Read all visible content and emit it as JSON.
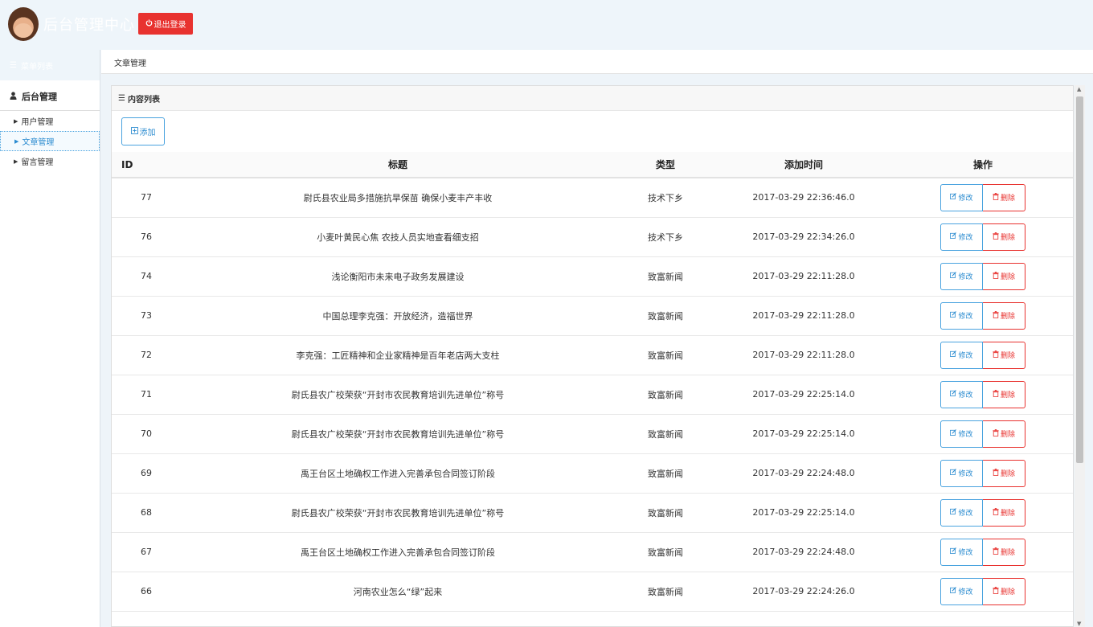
{
  "header": {
    "title": "后台管理中心",
    "logout_label": "退出登录",
    "logout_icon": "power-icon"
  },
  "sidebar": {
    "menu_title": "菜单列表",
    "section_title": "后台管理",
    "items": [
      {
        "label": "用户管理",
        "active": false
      },
      {
        "label": "文章管理",
        "active": true
      },
      {
        "label": "留言管理",
        "active": false
      }
    ]
  },
  "breadcrumb": {
    "current": "文章管理"
  },
  "panel": {
    "title": "内容列表",
    "add_label": "添加"
  },
  "table": {
    "headers": [
      "ID",
      "标题",
      "类型",
      "添加时间",
      "操作"
    ],
    "edit_label": "修改",
    "delete_label": "删除",
    "rows": [
      {
        "id": "77",
        "title": "尉氏县农业局多措施抗旱保苗 确保小麦丰产丰收",
        "type": "技术下乡",
        "time": "2017-03-29 22:36:46.0"
      },
      {
        "id": "76",
        "title": "小麦叶黄民心焦 农技人员实地查看细支招",
        "type": "技术下乡",
        "time": "2017-03-29 22:34:26.0"
      },
      {
        "id": "74",
        "title": "浅论衡阳市未来电子政务发展建设",
        "type": "致富新闻",
        "time": "2017-03-29 22:11:28.0"
      },
      {
        "id": "73",
        "title": "中国总理李克强：开放经济，造福世界",
        "type": "致富新闻",
        "time": "2017-03-29 22:11:28.0"
      },
      {
        "id": "72",
        "title": "李克强：工匠精神和企业家精神是百年老店两大支柱",
        "type": "致富新闻",
        "time": "2017-03-29 22:11:28.0"
      },
      {
        "id": "71",
        "title": "尉氏县农广校荣获“开封市农民教育培训先进单位”称号",
        "type": "致富新闻",
        "time": "2017-03-29 22:25:14.0"
      },
      {
        "id": "70",
        "title": "尉氏县农广校荣获“开封市农民教育培训先进单位”称号",
        "type": "致富新闻",
        "time": "2017-03-29 22:25:14.0"
      },
      {
        "id": "69",
        "title": "禹王台区土地确权工作进入完善承包合同签订阶段",
        "type": "致富新闻",
        "time": "2017-03-29 22:24:48.0"
      },
      {
        "id": "68",
        "title": "尉氏县农广校荣获“开封市农民教育培训先进单位”称号",
        "type": "致富新闻",
        "time": "2017-03-29 22:25:14.0"
      },
      {
        "id": "67",
        "title": "禹王台区土地确权工作进入完善承包合同签订阶段",
        "type": "致富新闻",
        "time": "2017-03-29 22:24:48.0"
      },
      {
        "id": "66",
        "title": "河南农业怎么“绿”起来",
        "type": "致富新闻",
        "time": "2017-03-29 22:24:26.0"
      }
    ]
  },
  "colors": {
    "accent": "#2a8bd0",
    "danger": "#e8322f",
    "header_bg": "#eef5fa"
  }
}
